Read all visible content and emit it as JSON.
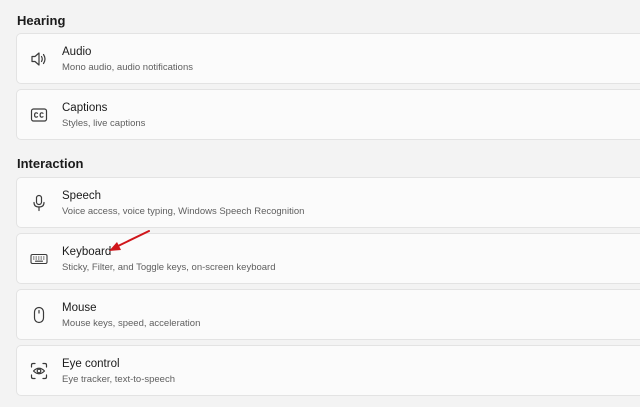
{
  "sections": [
    {
      "title": "Hearing",
      "items": [
        {
          "title": "Audio",
          "description": "Mono audio, audio notifications",
          "icon": "speaker-icon"
        },
        {
          "title": "Captions",
          "description": "Styles, live captions",
          "icon": "captions-icon"
        }
      ]
    },
    {
      "title": "Interaction",
      "items": [
        {
          "title": "Speech",
          "description": "Voice access, voice typing, Windows Speech Recognition",
          "icon": "microphone-icon"
        },
        {
          "title": "Keyboard",
          "description": "Sticky, Filter, and Toggle keys, on-screen keyboard",
          "icon": "keyboard-icon"
        },
        {
          "title": "Mouse",
          "description": "Mouse keys, speed, acceleration",
          "icon": "mouse-icon"
        },
        {
          "title": "Eye control",
          "description": "Eye tracker, text-to-speech",
          "icon": "eye-control-icon"
        }
      ]
    }
  ],
  "colors": {
    "annotation_arrow": "#d0161b",
    "background": "#f3f3f3",
    "card": "#fbfbfb"
  }
}
